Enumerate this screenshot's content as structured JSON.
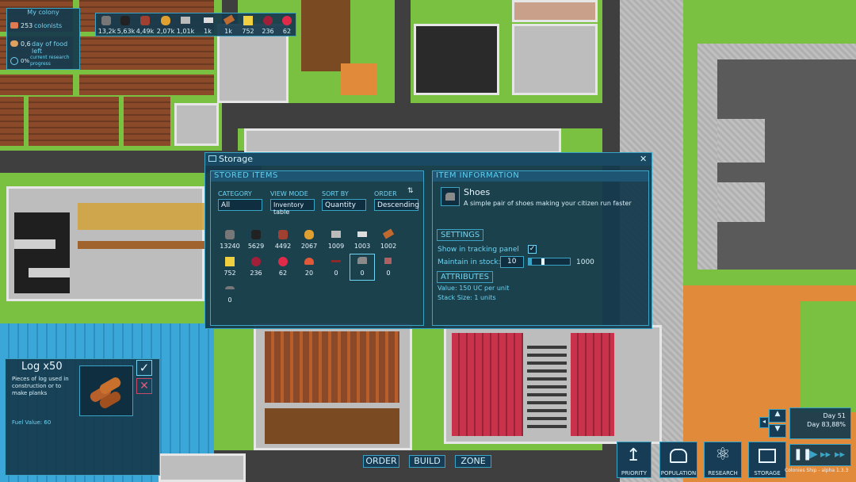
{
  "colony": {
    "title": "My colony",
    "colonists_value": "253",
    "colonists_label": "colonists",
    "food_value": "0,6",
    "food_label": "day of food left",
    "research_value": "0%",
    "research_label": "current research progress"
  },
  "resources_bar": [
    "13,2k",
    "5,63k",
    "4,49k",
    "2,07k",
    "1,01k",
    "1k",
    "1k",
    "752",
    "236",
    "62"
  ],
  "storage": {
    "title": "Storage",
    "stored_items_header": "STORED ITEMS",
    "category_label": "CATEGORY",
    "category_value": "All",
    "viewmode_label": "VIEW MODE",
    "viewmode_value": "Inventory table",
    "sortby_label": "SORT BY",
    "sortby_value": "Quantity",
    "order_label": "ORDER",
    "order_value": "Descending",
    "items": [
      {
        "icon": "stone-icon",
        "qty": "13240"
      },
      {
        "icon": "coal-icon",
        "qty": "5629"
      },
      {
        "icon": "iron-ore-icon",
        "qty": "4492"
      },
      {
        "icon": "food-icon",
        "qty": "2067"
      },
      {
        "icon": "metal-ingot-icon",
        "qty": "1009"
      },
      {
        "icon": "bar-icon",
        "qty": "1003"
      },
      {
        "icon": "plank-icon",
        "qty": "1002"
      },
      {
        "icon": "cheese-icon",
        "qty": "752"
      },
      {
        "icon": "berry-icon",
        "qty": "236"
      },
      {
        "icon": "apple-icon",
        "qty": "62"
      },
      {
        "icon": "pie-icon",
        "qty": "20"
      },
      {
        "icon": "tool-icon",
        "qty": "0"
      },
      {
        "icon": "shoes-icon",
        "qty": "0"
      },
      {
        "icon": "shirt-icon",
        "qty": "0"
      },
      {
        "icon": "hat-icon",
        "qty": "0"
      }
    ],
    "item_info_header": "ITEM INFORMATION",
    "item_name": "Shoes",
    "item_desc": "A simple pair of shoes making your citizen run faster",
    "settings_header": "SETTINGS",
    "tracking_label": "Show in tracking panel",
    "tracking_checked": true,
    "maintain_label": "Maintain in stock:",
    "maintain_value": "10",
    "maintain_max": "1000",
    "slider_level": 0.08,
    "attributes_header": "ATTRIBUTES",
    "value_text": "Value: 150 UC per unit",
    "stack_text": "Stack Size: 1 units"
  },
  "tooltip": {
    "title": "Log x50",
    "desc": "Pieces of log used in construction or to make planks",
    "fuel": "Fuel Value: 60"
  },
  "bottom_buttons": {
    "order": "ORDER",
    "build": "BUILD",
    "zone": "ZONE"
  },
  "nav": {
    "priority": "PRIORITY",
    "population": "POPULATION",
    "research": "RESEARCH",
    "storage": "STORAGE"
  },
  "time": {
    "day": "Day 51",
    "progress": "Day 83,88%"
  },
  "version_text": "Colonies Ship - alpha 1.3.3"
}
